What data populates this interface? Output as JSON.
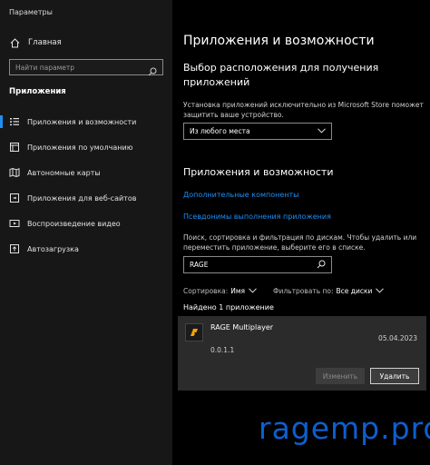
{
  "window": {
    "title": "Параметры"
  },
  "sidebar": {
    "home_label": "Главная",
    "search_placeholder": "Найти параметр",
    "section_title": "Приложения",
    "items": [
      {
        "label": "Приложения и возможности",
        "icon": "apps-list-icon",
        "selected": true
      },
      {
        "label": "Приложения по умолчанию",
        "icon": "default-apps-icon",
        "selected": false
      },
      {
        "label": "Автономные карты",
        "icon": "offline-maps-icon",
        "selected": false
      },
      {
        "label": "Приложения для веб-сайтов",
        "icon": "websites-apps-icon",
        "selected": false
      },
      {
        "label": "Воспроизведение видео",
        "icon": "video-playback-icon",
        "selected": false
      },
      {
        "label": "Автозагрузка",
        "icon": "startup-icon",
        "selected": false
      }
    ]
  },
  "main": {
    "title": "Приложения и возможности",
    "location": {
      "heading_line1": "Выбор расположения для получения",
      "heading_line2": "приложений",
      "desc_line1": "Установка приложений исключительно из Microsoft Store поможет",
      "desc_line2": "защитить ваше устройство.",
      "dropdown_value": "Из любого места"
    },
    "apps": {
      "heading": "Приложения и возможности",
      "link_optional": "Дополнительные компоненты",
      "link_aliases": "Псевдонимы выполнения приложения",
      "desc_line1": "Поиск, сортировка и фильтрация по дискам. Чтобы удалить или",
      "desc_line2": "переместить приложение, выберите его в списке.",
      "search_value": "RAGE",
      "sort_label": "Сортировка:",
      "sort_value": "Имя",
      "filter_label": "Фильтровать по:",
      "filter_value": "Все диски",
      "found_text": "Найдено 1 приложение"
    },
    "app_item": {
      "name": "RAGE Multiplayer",
      "date": "05.04.2023",
      "version": "0.0.1.1",
      "modify_label": "Изменить",
      "remove_label": "Удалить"
    }
  },
  "watermark": "ragemp.pro",
  "colors": {
    "accent": "#1f8ff5",
    "sidebar_bg": "#171717",
    "main_bg": "#000000",
    "card_bg": "#2b2b2b",
    "watermark": "#0d5fcf",
    "app_logo": "#f5a300"
  }
}
